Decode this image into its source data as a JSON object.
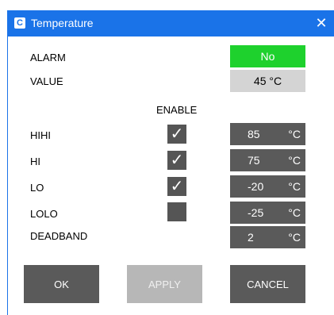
{
  "window": {
    "title": "Temperature",
    "app_icon_letter": "C",
    "close_glyph": "✕"
  },
  "status": {
    "alarm_label": "ALARM",
    "alarm_value": "No",
    "value_label": "VALUE",
    "value_value": "45 °C"
  },
  "enable_header": "ENABLE",
  "limits": [
    {
      "label": "HIHI",
      "enabled": true,
      "value": "85",
      "unit": "°C",
      "check": "✓"
    },
    {
      "label": "HI",
      "enabled": true,
      "value": "75",
      "unit": "°C",
      "check": "✓"
    },
    {
      "label": "LO",
      "enabled": true,
      "value": "-20",
      "unit": "°C",
      "check": "✓"
    },
    {
      "label": "LOLO",
      "enabled": false,
      "value": "-25",
      "unit": "°C",
      "check": ""
    }
  ],
  "deadband": {
    "label": "DEADBAND",
    "value": "2",
    "unit": "°C"
  },
  "buttons": {
    "ok": "OK",
    "apply": "APPLY",
    "cancel": "CANCEL"
  },
  "colors": {
    "titlebar": "#1a73e8",
    "alarm_ok": "#1ed12d",
    "field": "#5a5a5a",
    "apply_disabled": "#b7b7b7"
  }
}
